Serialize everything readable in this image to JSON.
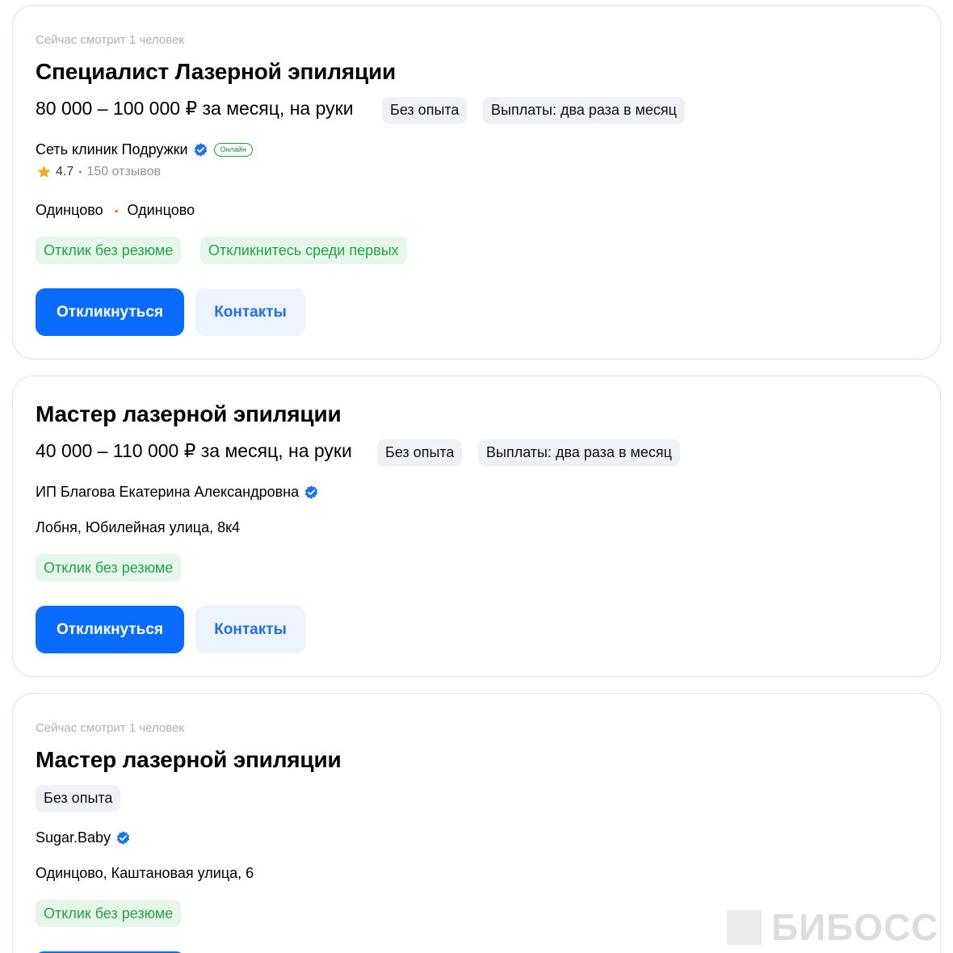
{
  "vacancies": [
    {
      "viewers": "Сейчас смотрит 1 человек",
      "title": "Специалист Лазерной эпиляции",
      "salary": "80 000 – 100 000 ₽ за месяц, на руки",
      "tags": [
        "Без опыта",
        "Выплаты: два раза в месяц"
      ],
      "company": "Сеть клиник Подружки",
      "online_badge": "Онлайн",
      "rating": "4.7",
      "reviews": "150 отзывов",
      "location_city": "Одинцово",
      "location_metro": "Одинцово",
      "green_tags": [
        "Отклик без резюме",
        "Откликнитесь среди первых"
      ],
      "apply_label": "Откликнуться",
      "contacts_label": "Контакты"
    },
    {
      "title": "Мастер лазерной эпиляции",
      "salary": "40 000 – 110 000 ₽ за месяц, на руки",
      "tags": [
        "Без опыта",
        "Выплаты: два раза в месяц"
      ],
      "company": "ИП Благова Екатерина Александровна",
      "location": "Лобня, Юбилейная улица, 8к4",
      "green_tags": [
        "Отклик без резюме"
      ],
      "apply_label": "Откликнуться",
      "contacts_label": "Контакты"
    },
    {
      "viewers": "Сейчас смотрит 1 человек",
      "title": "Мастер лазерной эпиляции",
      "tags": [
        "Без опыта"
      ],
      "company": "Sugar.Baby",
      "location": "Одинцово, Каштановая улица, 6",
      "green_tags": [
        "Отклик без резюме"
      ]
    }
  ],
  "watermark": "БИБОСС",
  "colors": {
    "primary_button": "#0a6cff",
    "secondary_button": "#eef4ff",
    "green_tag_bg": "#e7f6ea",
    "green_tag_text": "#22a344",
    "verified": "#1a73e8",
    "star": "#f5a623",
    "metro_dot": "#ff7a1a"
  },
  "icons": [
    "verified-icon",
    "star-icon",
    "metro-dot-icon"
  ]
}
